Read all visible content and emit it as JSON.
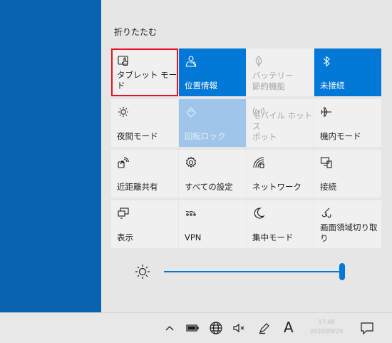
{
  "collapse_label": "折りたたむ",
  "tiles": [
    {
      "label": "タブレット モード",
      "icon": "tablet-mode-icon",
      "state": "highlight"
    },
    {
      "label": "位置情報",
      "icon": "location-icon",
      "state": "active"
    },
    {
      "label": "バッテリー\n節約機能",
      "icon": "battery-saver-icon",
      "state": "disabled"
    },
    {
      "label": "未接続",
      "icon": "bluetooth-icon",
      "state": "active"
    },
    {
      "label": "夜間モード",
      "icon": "night-light-icon",
      "state": "normal"
    },
    {
      "label": "回転ロック",
      "icon": "rotation-lock-icon",
      "state": "disabled-active"
    },
    {
      "label": "モバイル ホットス\nポット",
      "icon": "mobile-hotspot-icon",
      "state": "disabled"
    },
    {
      "label": "機内モード",
      "icon": "airplane-mode-icon",
      "state": "normal"
    },
    {
      "label": "近距離共有",
      "icon": "nearby-share-icon",
      "state": "normal"
    },
    {
      "label": "すべての設定",
      "icon": "settings-icon",
      "state": "normal"
    },
    {
      "label": "ネットワーク",
      "icon": "network-icon",
      "state": "normal"
    },
    {
      "label": "接続",
      "icon": "connect-icon",
      "state": "normal"
    },
    {
      "label": "表示",
      "icon": "project-icon",
      "state": "normal"
    },
    {
      "label": "VPN",
      "icon": "vpn-icon",
      "state": "normal"
    },
    {
      "label": "集中モード",
      "icon": "focus-assist-icon",
      "state": "normal"
    },
    {
      "label": "画面領域切り取\nり",
      "icon": "snip-icon",
      "state": "normal"
    }
  ],
  "brightness": {
    "level": 1.0,
    "icon": "brightness-icon"
  },
  "taskbar": {
    "ime_label": "A",
    "clock_time": "17:48",
    "clock_date": "2020/09/29"
  }
}
